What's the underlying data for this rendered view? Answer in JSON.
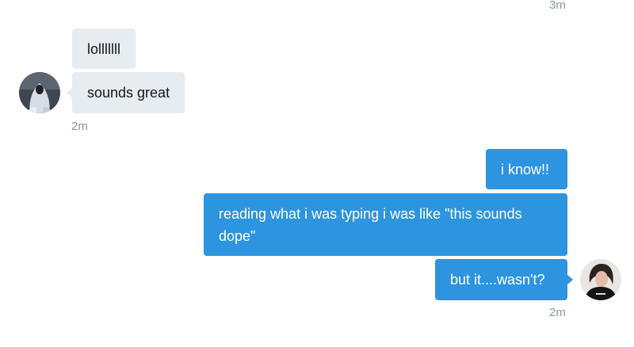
{
  "conversation": {
    "top_timestamp": "3m",
    "incoming_group": {
      "messages": [
        "lolllllll",
        "sounds great"
      ],
      "timestamp": "2m"
    },
    "outgoing_group": {
      "messages": [
        "i know!!",
        "reading what i was typing i was like \"this sounds dope\"",
        "but it....wasn't?"
      ],
      "timestamp": "2m"
    }
  },
  "icons": {
    "incoming_avatar": "ghost-costume-avatar",
    "outgoing_avatar": "user-photo-avatar"
  },
  "colors": {
    "incoming_bubble": "#e6ecf0",
    "outgoing_bubble": "#2d94e0",
    "timestamp": "#8899a6"
  }
}
